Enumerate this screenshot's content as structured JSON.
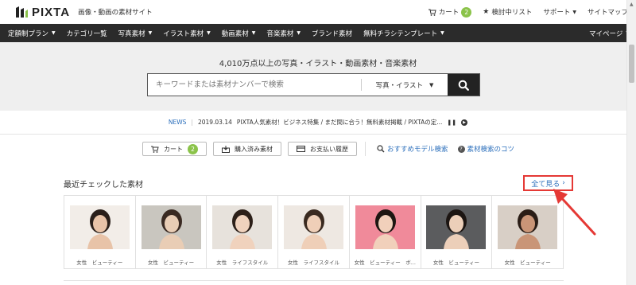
{
  "header": {
    "logo_text": "PIXTA",
    "tagline": "画像・動画の素材サイト",
    "cart_label": "カート",
    "cart_count": "2",
    "wishlist_label": "検討中リスト",
    "support_label": "サポート",
    "sitemap_label": "サイトマップ"
  },
  "nav": {
    "items": [
      {
        "label": "定額制プラン",
        "caret": true
      },
      {
        "label": "カテゴリ一覧",
        "caret": false
      },
      {
        "label": "写真素材",
        "caret": true
      },
      {
        "label": "イラスト素材",
        "caret": true
      },
      {
        "label": "動画素材",
        "caret": true
      },
      {
        "label": "音楽素材",
        "caret": true
      },
      {
        "label": "ブランド素材",
        "caret": false
      },
      {
        "label": "無料チラシテンプレート",
        "caret": true
      }
    ],
    "mypage_label": "マイページ"
  },
  "search": {
    "headline": "4,010万点以上の写真・イラスト・動画素材・音楽素材",
    "placeholder": "キーワードまたは素材ナンバーで検索",
    "category": "写真・イラスト"
  },
  "news": {
    "label": "NEWS",
    "date": "2019.03.14",
    "text": "PIXTA人気素材！ビジネス特集 / まだ間に合う！無料素材掲載 / PIXTAの定..."
  },
  "quick_links": {
    "cart_label": "カート",
    "cart_count": "2",
    "purchased_label": "購入済み素材",
    "payment_label": "お支払い履歴",
    "model_search_label": "おすすめモデル検索",
    "tips_label": "素材検索のコツ"
  },
  "recent": {
    "title": "最近チェックした素材",
    "see_all_label": "全て見る",
    "items": [
      {
        "tags": "女性　ビューティー",
        "bg": "#f2ede8",
        "skin": "#e8c3a8",
        "hair": "#2a1f1a"
      },
      {
        "tags": "女性　ビューティー",
        "bg": "#c9c6bf",
        "skin": "#e9cdb5",
        "hair": "#3a2a22"
      },
      {
        "tags": "女性　ライフスタイル",
        "bg": "#e7e2dc",
        "skin": "#f0d2bd",
        "hair": "#2d2019"
      },
      {
        "tags": "女性　ライフスタイル",
        "bg": "#eee8e2",
        "skin": "#efcfb8",
        "hair": "#3a2a20"
      },
      {
        "tags": "女性　ビューティー　ボ...",
        "bg": "#f08a9a",
        "skin": "#f1d0bb",
        "hair": "#1e1612"
      },
      {
        "tags": "女性　ビューティー",
        "bg": "#5b5c5e",
        "skin": "#eccfb9",
        "hair": "#1c1512"
      },
      {
        "tags": "女性　ビューティー",
        "bg": "#d8cfc6",
        "skin": "#c99577",
        "hair": "#2a1d16"
      }
    ]
  },
  "colors": {
    "nav_bg": "#2b2b2b",
    "search_bg": "#efefef",
    "link": "#2a6ebb",
    "badge": "#8bc34a",
    "annotation": "#e53935"
  }
}
